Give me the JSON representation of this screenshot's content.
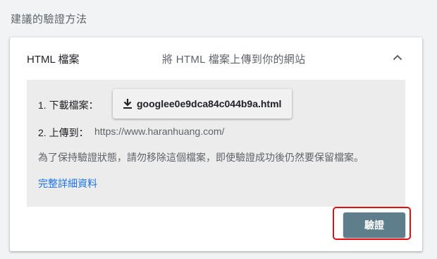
{
  "section": {
    "title": "建議的驗證方法"
  },
  "method": {
    "label": "HTML 檔案",
    "description": "將 HTML 檔案上傳到你的網站",
    "collapse_icon": "chevron-up-icon"
  },
  "steps": {
    "download_label": "1. 下載檔案：",
    "download_filename": "googlee0e9dca84c044b9a.html",
    "download_icon": "download-icon",
    "upload_label": "2. 上傳到：",
    "upload_url": "https://www.haranhuang.com/"
  },
  "notice": "為了保持驗證狀態，請勿移除這個檔案，即使驗證成功後仍然要保留檔案。",
  "details_link": "完整詳細資料",
  "verify_button": "驗證",
  "colors": {
    "verify_button_bg": "#5f7e8c",
    "link": "#1a73e8",
    "highlight": "#e01010",
    "panel_bg": "#ececec"
  }
}
